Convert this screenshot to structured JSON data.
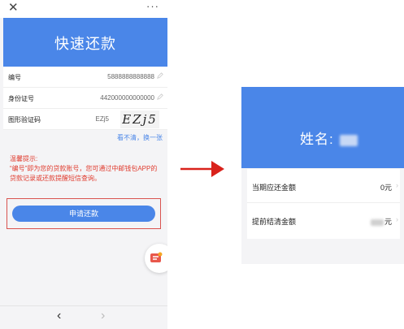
{
  "left": {
    "page_title": "快速还款",
    "topbar": {
      "close_glyph": "✕",
      "more_glyph": "···"
    },
    "fields": [
      {
        "label": "编号",
        "value": "5888888888888"
      },
      {
        "label": "身份证号",
        "value": "442000000000000"
      },
      {
        "label": "图形验证码",
        "value": "EZj5"
      }
    ],
    "captcha_text": "EZj5",
    "refresh_link": "看不清，换一张",
    "tips": {
      "title": "温馨提示:",
      "body": "“编号”即为您的贷款账号，您可通过中邮钱包APP的贷款记录或还款提醒短信查询。"
    },
    "submit_label": "申请还款",
    "nav": {
      "back": "‹",
      "forward": "›"
    }
  },
  "right": {
    "name_label": "姓名:",
    "rows": [
      {
        "label": "当期应还金额",
        "value": "0元"
      },
      {
        "label": "提前结清金额",
        "value": "元"
      }
    ]
  },
  "colors": {
    "brand_blue": "#4a86e8",
    "tip_red": "#e03b2e",
    "arrow_red": "#d9221b"
  }
}
